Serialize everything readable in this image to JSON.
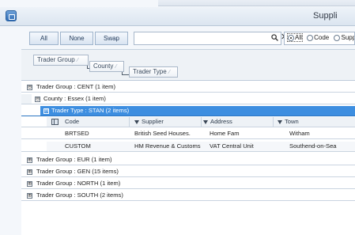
{
  "window": {
    "title": "Suppli"
  },
  "toolbar": {
    "all_label": "All",
    "none_label": "None",
    "swap_label": "Swap",
    "search": {
      "value": "",
      "placeholder": ""
    },
    "filters": [
      {
        "label": "All",
        "checked": true
      },
      {
        "label": "Code",
        "checked": false
      },
      {
        "label": "Supplier",
        "checked": false
      }
    ]
  },
  "groupby": {
    "chips": [
      "Trader Group",
      "County",
      "Trader Type"
    ]
  },
  "grid": {
    "group_cent": "Trader Group : CENT (1 item)",
    "county_essex": "County : Essex (1 item)",
    "type_stan": "Trader Type : STAN (2 items)",
    "columns": [
      "Code",
      "Supplier",
      "Address",
      "Town"
    ],
    "rows": [
      [
        "BRTSED",
        "British Seed Houses.",
        "Home Fam",
        "Witham"
      ],
      [
        "CUSTOM",
        "HM Revenue & Customs",
        "VAT Central Unit",
        "Southend-on-Sea"
      ]
    ],
    "other_groups": [
      "Trader Group : EUR (1 item)",
      "Trader Group : GEN (15 items)",
      "Trader Group : NORTH (1 item)",
      "Trader Group : SOUTH (2 items)"
    ],
    "expanded_glyph": "⊟",
    "collapsed_glyph": "⊞"
  },
  "colors": {
    "selection": "#3d8ee0",
    "header_bg": "#eef2f6",
    "button_text": "#233b5b"
  },
  "icons": {
    "app": "app-icon",
    "search": "search-icon",
    "clear": "clear-icon",
    "filter": "filter-icon",
    "column_chooser": "column-chooser-icon"
  }
}
